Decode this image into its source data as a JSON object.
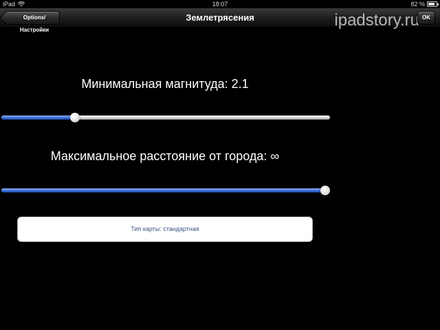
{
  "status_bar": {
    "carrier": "iPad",
    "time": "18:07",
    "battery_text": "82 %",
    "battery_level": 0.82
  },
  "nav_bar": {
    "title": "Землетрясения",
    "back_label": "Options/Настройки",
    "ok_label": "OK"
  },
  "watermark": "ipadstory.ru",
  "settings": {
    "min_magnitude": {
      "label": "Минимальная магнитуда: 2.1",
      "value_fraction": 0.215
    },
    "max_distance": {
      "label": "Максимальное расстояние от города: ∞",
      "value_fraction": 1.0
    },
    "map_type_label": "Тип карты: стандартная"
  },
  "colors": {
    "background": "#000000",
    "slider_fill": "#3f6fd8",
    "map_type_text": "#3d5585"
  }
}
